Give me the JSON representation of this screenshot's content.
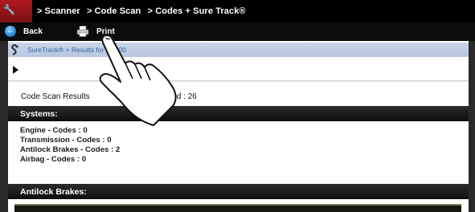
{
  "header": {
    "crumbs": [
      "> Scanner",
      "> Code Scan",
      "> Codes + Sure Track®"
    ]
  },
  "toolbar": {
    "back_label": "Back",
    "print_label": "Print"
  },
  "breadcrumb2": {
    "text": "SureTrack®  > Results for U0100"
  },
  "results": {
    "label": "Code Scan Results",
    "count": "detected : 26"
  },
  "systems": {
    "header": "Systems:",
    "items": [
      "Engine - Codes : 0",
      "Transmission - Codes : 0",
      "Antilock Brakes - Codes : 2",
      "Airbag - Codes : 0"
    ]
  },
  "abs": {
    "header": "Antilock Brakes:"
  },
  "colors": {
    "header_bg": "#000000",
    "accent_blue": "#3560a0",
    "home_red": "#b01820"
  },
  "icons": [
    "home-icon",
    "back-icon",
    "print-icon",
    "suretrack-icon",
    "expand-arrow-icon",
    "hand-pointer-icon"
  ]
}
